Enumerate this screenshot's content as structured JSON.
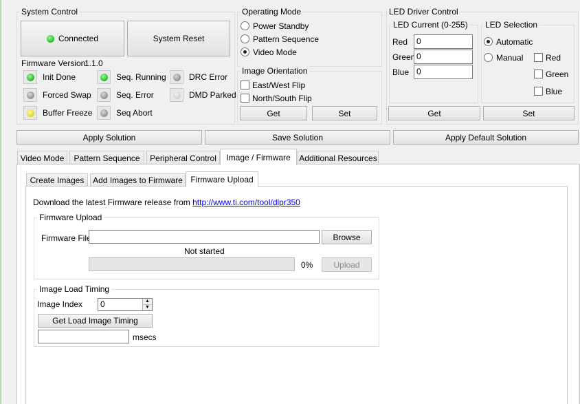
{
  "system_control": {
    "title": "System Control",
    "connected_label": "Connected",
    "system_reset_label": "System Reset",
    "firmware_version_label": "Firmware Version:",
    "firmware_version": "1.1.0",
    "status": [
      {
        "label": "Init Done",
        "color": "green"
      },
      {
        "label": "Seq. Running",
        "color": "green"
      },
      {
        "label": "DRC Error",
        "color": "gray"
      },
      {
        "label": "Forced Swap",
        "color": "gray"
      },
      {
        "label": "Seq. Error",
        "color": "gray"
      },
      {
        "label": "DMD Parked",
        "color": "lightgray"
      },
      {
        "label": "Buffer Freeze",
        "color": "yellow"
      },
      {
        "label": "Seq Abort",
        "color": "gray"
      }
    ]
  },
  "operating_mode": {
    "title": "Operating Mode",
    "options": [
      "Power Standby",
      "Pattern Sequence",
      "Video Mode"
    ],
    "selected": "Video Mode"
  },
  "image_orientation": {
    "title": "Image Orientation",
    "options": [
      "East/West Flip",
      "North/South Flip"
    ],
    "get_label": "Get",
    "set_label": "Set"
  },
  "led_driver": {
    "title": "LED Driver Control",
    "current_title": "LED Current (0-255)",
    "red_label": "Red",
    "red_value": "0",
    "green_label": "Green",
    "green_value": "0",
    "blue_label": "Blue",
    "blue_value": "0",
    "selection_title": "LED Selection",
    "automatic_label": "Automatic",
    "manual_label": "Manual",
    "selected": "Automatic",
    "manual_red": "Red",
    "manual_green": "Green",
    "manual_blue": "Blue",
    "get_label": "Get",
    "set_label": "Set"
  },
  "solution": {
    "apply_label": "Apply Solution",
    "save_label": "Save Solution",
    "apply_default_label": "Apply Default Solution"
  },
  "main_tabs": [
    "Video Mode",
    "Pattern Sequence",
    "Peripheral Control",
    "Image / Firmware",
    "Additional Resources"
  ],
  "main_active_tab": "Image / Firmware",
  "sub_tabs": [
    "Create Images",
    "Add Images to Firmware",
    "Firmware Upload"
  ],
  "sub_active_tab": "Firmware Upload",
  "firmware": {
    "download_text": "Download the latest Firmware release from",
    "download_link": "http://www.ti.com/tool/dlpr350",
    "upload_title": "Firmware Upload",
    "file_label": "Firmware File:",
    "file_value": "",
    "browse_label": "Browse",
    "status_text": "Not started",
    "progress_percent": 0,
    "progress_text": "0%",
    "upload_label": "Upload"
  },
  "image_load_timing": {
    "title": "Image Load Timing",
    "index_label": "Image Index",
    "index_value": "0",
    "button_label": "Get Load Image Timing",
    "result_value": "",
    "unit_label": "msecs"
  }
}
